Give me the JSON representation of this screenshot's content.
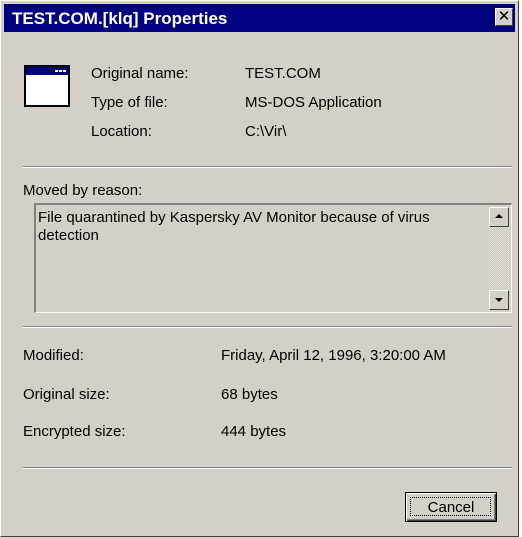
{
  "window": {
    "title": "TEST.COM.[klq] Properties"
  },
  "file_info": {
    "original_name_label": "Original name:",
    "original_name_value": "TEST.COM",
    "type_label": "Type of file:",
    "type_value": "MS-DOS Application",
    "location_label": "Location:",
    "location_value": "C:\\Vir\\"
  },
  "reason": {
    "label": "Moved by reason:",
    "text": "File quarantined by Kaspersky AV Monitor because of virus detection"
  },
  "details": {
    "modified_label": "Modified:",
    "modified_value": "Friday, April 12, 1996, 3:20:00 AM",
    "original_size_label": "Original size:",
    "original_size_value": "68 bytes",
    "encrypted_size_label": "Encrypted size:",
    "encrypted_size_value": "444 bytes"
  },
  "buttons": {
    "cancel_label": "Cancel"
  },
  "icons": {
    "file": "application-window-icon",
    "close": "close-icon"
  },
  "colors": {
    "titlebar": "#000080",
    "face": "#d4d0c8"
  }
}
